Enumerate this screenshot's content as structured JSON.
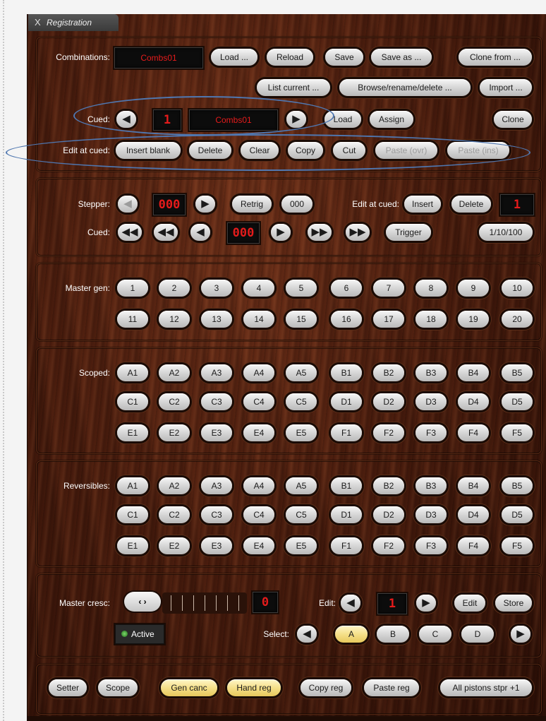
{
  "window_title": "Registration",
  "tab_close": "X",
  "combinations": {
    "label": "Combinations:",
    "display": "Combs01",
    "load": "Load ...",
    "reload": "Reload",
    "save": "Save",
    "save_as": "Save as ...",
    "clone_from": "Clone from ...",
    "list_current": "List current ...",
    "browse": "Browse/rename/delete ...",
    "import": "Import ..."
  },
  "cued": {
    "label": "Cued:",
    "prev": "◀",
    "number": "1",
    "name": "Combs01",
    "next": "▶",
    "load": "Load",
    "assign": "Assign",
    "clone": "Clone"
  },
  "edit_at_cued": {
    "label": "Edit at cued:",
    "insert_blank": "Insert blank",
    "delete": "Delete",
    "clear": "Clear",
    "copy": "Copy",
    "cut": "Cut",
    "paste_ovr": "Paste (ovr)",
    "paste_ins": "Paste (ins)"
  },
  "stepper": {
    "label": "Stepper:",
    "prev": "◀",
    "value": "000",
    "next": "▶",
    "retrig": "Retrig",
    "zero": "000",
    "edit_label": "Edit at cued:",
    "insert": "Insert",
    "delete": "Delete",
    "edit_value": "1",
    "cued_label": "Cued:",
    "first": "◀◀",
    "back10": "◀◀",
    "back1": "◀",
    "cued_value": "000",
    "fwd1": "▶",
    "fwd10": "▶▶",
    "last": "▶▶",
    "trigger": "Trigger",
    "step": "1/10/100"
  },
  "master_gen": {
    "label": "Master gen:",
    "buttons": [
      "1",
      "2",
      "3",
      "4",
      "5",
      "6",
      "7",
      "8",
      "9",
      "10",
      "11",
      "12",
      "13",
      "14",
      "15",
      "16",
      "17",
      "18",
      "19",
      "20"
    ]
  },
  "scoped": {
    "label": "Scoped:",
    "buttons": [
      "A1",
      "A2",
      "A3",
      "A4",
      "A5",
      "B1",
      "B2",
      "B3",
      "B4",
      "B5",
      "C1",
      "C2",
      "C3",
      "C4",
      "C5",
      "D1",
      "D2",
      "D3",
      "D4",
      "D5",
      "E1",
      "E2",
      "E3",
      "E4",
      "E5",
      "F1",
      "F2",
      "F3",
      "F4",
      "F5"
    ]
  },
  "reversibles": {
    "label": "Reversibles:",
    "buttons": [
      "A1",
      "A2",
      "A3",
      "A4",
      "A5",
      "B1",
      "B2",
      "B3",
      "B4",
      "B5",
      "C1",
      "C2",
      "C3",
      "C4",
      "C5",
      "D1",
      "D2",
      "D3",
      "D4",
      "D5",
      "E1",
      "E2",
      "E3",
      "E4",
      "E5",
      "F1",
      "F2",
      "F3",
      "F4",
      "F5"
    ]
  },
  "master_cresc": {
    "label": "Master cresc:",
    "knob": "‹ ›",
    "value": "0",
    "active": "Active",
    "edit_label": "Edit:",
    "edit_prev": "◀",
    "edit_value": "1",
    "edit_next": "▶",
    "edit": "Edit",
    "store": "Store",
    "select_label": "Select:",
    "select_prev": "◀",
    "select_options": [
      "A",
      "B",
      "C",
      "D"
    ],
    "select_selected": "A",
    "select_next": "▶"
  },
  "footer_buttons": {
    "setter": "Setter",
    "scope": "Scope",
    "gen_canc": "Gen canc",
    "hand_reg": "Hand reg",
    "copy_reg": "Copy reg",
    "paste_reg": "Paste reg",
    "all_pistons": "All pistons stpr +1"
  },
  "colors": {
    "wood": "#4a1c0d",
    "display_text": "#e51b1b",
    "highlight_yellow": "#f5e08a",
    "annotation_oval": "#4f77b0"
  }
}
